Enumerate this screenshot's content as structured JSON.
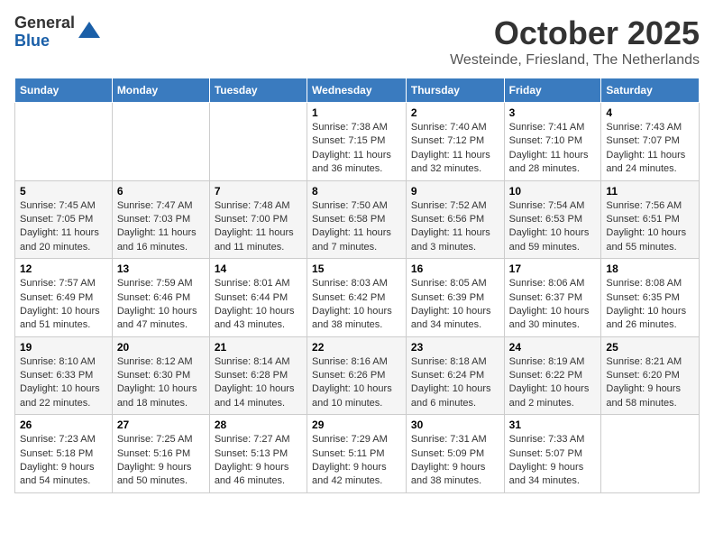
{
  "header": {
    "logo_general": "General",
    "logo_blue": "Blue",
    "month_title": "October 2025",
    "location": "Westeinde, Friesland, The Netherlands"
  },
  "weekdays": [
    "Sunday",
    "Monday",
    "Tuesday",
    "Wednesday",
    "Thursday",
    "Friday",
    "Saturday"
  ],
  "weeks": [
    [
      {
        "day": "",
        "info": ""
      },
      {
        "day": "",
        "info": ""
      },
      {
        "day": "",
        "info": ""
      },
      {
        "day": "1",
        "info": "Sunrise: 7:38 AM\nSunset: 7:15 PM\nDaylight: 11 hours\nand 36 minutes."
      },
      {
        "day": "2",
        "info": "Sunrise: 7:40 AM\nSunset: 7:12 PM\nDaylight: 11 hours\nand 32 minutes."
      },
      {
        "day": "3",
        "info": "Sunrise: 7:41 AM\nSunset: 7:10 PM\nDaylight: 11 hours\nand 28 minutes."
      },
      {
        "day": "4",
        "info": "Sunrise: 7:43 AM\nSunset: 7:07 PM\nDaylight: 11 hours\nand 24 minutes."
      }
    ],
    [
      {
        "day": "5",
        "info": "Sunrise: 7:45 AM\nSunset: 7:05 PM\nDaylight: 11 hours\nand 20 minutes."
      },
      {
        "day": "6",
        "info": "Sunrise: 7:47 AM\nSunset: 7:03 PM\nDaylight: 11 hours\nand 16 minutes."
      },
      {
        "day": "7",
        "info": "Sunrise: 7:48 AM\nSunset: 7:00 PM\nDaylight: 11 hours\nand 11 minutes."
      },
      {
        "day": "8",
        "info": "Sunrise: 7:50 AM\nSunset: 6:58 PM\nDaylight: 11 hours\nand 7 minutes."
      },
      {
        "day": "9",
        "info": "Sunrise: 7:52 AM\nSunset: 6:56 PM\nDaylight: 11 hours\nand 3 minutes."
      },
      {
        "day": "10",
        "info": "Sunrise: 7:54 AM\nSunset: 6:53 PM\nDaylight: 10 hours\nand 59 minutes."
      },
      {
        "day": "11",
        "info": "Sunrise: 7:56 AM\nSunset: 6:51 PM\nDaylight: 10 hours\nand 55 minutes."
      }
    ],
    [
      {
        "day": "12",
        "info": "Sunrise: 7:57 AM\nSunset: 6:49 PM\nDaylight: 10 hours\nand 51 minutes."
      },
      {
        "day": "13",
        "info": "Sunrise: 7:59 AM\nSunset: 6:46 PM\nDaylight: 10 hours\nand 47 minutes."
      },
      {
        "day": "14",
        "info": "Sunrise: 8:01 AM\nSunset: 6:44 PM\nDaylight: 10 hours\nand 43 minutes."
      },
      {
        "day": "15",
        "info": "Sunrise: 8:03 AM\nSunset: 6:42 PM\nDaylight: 10 hours\nand 38 minutes."
      },
      {
        "day": "16",
        "info": "Sunrise: 8:05 AM\nSunset: 6:39 PM\nDaylight: 10 hours\nand 34 minutes."
      },
      {
        "day": "17",
        "info": "Sunrise: 8:06 AM\nSunset: 6:37 PM\nDaylight: 10 hours\nand 30 minutes."
      },
      {
        "day": "18",
        "info": "Sunrise: 8:08 AM\nSunset: 6:35 PM\nDaylight: 10 hours\nand 26 minutes."
      }
    ],
    [
      {
        "day": "19",
        "info": "Sunrise: 8:10 AM\nSunset: 6:33 PM\nDaylight: 10 hours\nand 22 minutes."
      },
      {
        "day": "20",
        "info": "Sunrise: 8:12 AM\nSunset: 6:30 PM\nDaylight: 10 hours\nand 18 minutes."
      },
      {
        "day": "21",
        "info": "Sunrise: 8:14 AM\nSunset: 6:28 PM\nDaylight: 10 hours\nand 14 minutes."
      },
      {
        "day": "22",
        "info": "Sunrise: 8:16 AM\nSunset: 6:26 PM\nDaylight: 10 hours\nand 10 minutes."
      },
      {
        "day": "23",
        "info": "Sunrise: 8:18 AM\nSunset: 6:24 PM\nDaylight: 10 hours\nand 6 minutes."
      },
      {
        "day": "24",
        "info": "Sunrise: 8:19 AM\nSunset: 6:22 PM\nDaylight: 10 hours\nand 2 minutes."
      },
      {
        "day": "25",
        "info": "Sunrise: 8:21 AM\nSunset: 6:20 PM\nDaylight: 9 hours\nand 58 minutes."
      }
    ],
    [
      {
        "day": "26",
        "info": "Sunrise: 7:23 AM\nSunset: 5:18 PM\nDaylight: 9 hours\nand 54 minutes."
      },
      {
        "day": "27",
        "info": "Sunrise: 7:25 AM\nSunset: 5:16 PM\nDaylight: 9 hours\nand 50 minutes."
      },
      {
        "day": "28",
        "info": "Sunrise: 7:27 AM\nSunset: 5:13 PM\nDaylight: 9 hours\nand 46 minutes."
      },
      {
        "day": "29",
        "info": "Sunrise: 7:29 AM\nSunset: 5:11 PM\nDaylight: 9 hours\nand 42 minutes."
      },
      {
        "day": "30",
        "info": "Sunrise: 7:31 AM\nSunset: 5:09 PM\nDaylight: 9 hours\nand 38 minutes."
      },
      {
        "day": "31",
        "info": "Sunrise: 7:33 AM\nSunset: 5:07 PM\nDaylight: 9 hours\nand 34 minutes."
      },
      {
        "day": "",
        "info": ""
      }
    ]
  ]
}
